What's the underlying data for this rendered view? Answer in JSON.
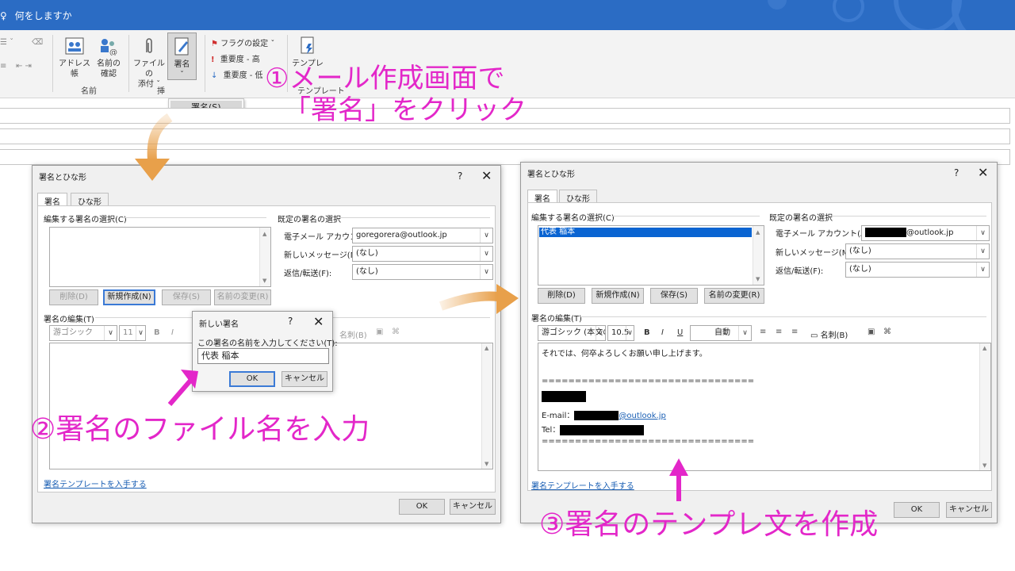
{
  "titlebar": {
    "tell_me": "何をしますか"
  },
  "ribbon": {
    "address_book": "アドレス帳",
    "check_names_line1": "名前の",
    "check_names_line2": "確認",
    "group_names": "名前",
    "attach_line1": "ファイルの",
    "attach_line2": "添付 ˇ",
    "signature": "署名",
    "group_insert_partial": "挿",
    "flag": "フラグの設定 ˇ",
    "high_importance": "重要度 - 高",
    "low_importance": "重要度 - 低",
    "template_line1": "テンプレ",
    "template_group_partial": "テンプレート",
    "dropdown_item": "署名(S)..."
  },
  "dialog_left": {
    "title": "署名とひな形",
    "help": "?",
    "close": "✕",
    "tab_signature": "署名",
    "tab_stationery": "ひな形",
    "select_label": "編集する署名の選択(C)",
    "default_label": "既定の署名の選択",
    "account_label": "電子メール アカウント(A):",
    "account_value": "goregorera@outlook.jp",
    "new_msg_label": "新しいメッセージ(M):",
    "new_msg_value": "(なし)",
    "reply_label": "返信/転送(F):",
    "reply_value": "(なし)",
    "btn_delete": "削除(D)",
    "btn_new": "新規作成(N)",
    "btn_save": "保存(S)",
    "btn_rename": "名前の変更(R)",
    "edit_label": "署名の編集(T)",
    "font_value": "游ゴシック",
    "size_value": "11",
    "bizcard": "名刺(B)",
    "template_link": "署名テンプレートを入手する",
    "ok": "OK",
    "cancel": "キャンセル"
  },
  "new_sig_dialog": {
    "title": "新しい署名",
    "help": "?",
    "close": "✕",
    "prompt": "この署名の名前を入力してください(T):",
    "value": "代表 稲本",
    "ok": "OK",
    "cancel": "キャンセル"
  },
  "dialog_right": {
    "title": "署名とひな形",
    "help": "?",
    "close": "✕",
    "tab_signature": "署名",
    "tab_stationery": "ひな形",
    "select_label": "編集する署名の選択(C)",
    "list_item": "代表 稲本",
    "default_label": "既定の署名の選択",
    "account_label": "電子メール アカウント(A):",
    "account_value": "@outlook.jp",
    "new_msg_label": "新しいメッセージ(M):",
    "new_msg_value": "(なし)",
    "reply_label": "返信/転送(F):",
    "reply_value": "(なし)",
    "btn_delete": "削除(D)",
    "btn_new": "新規作成(N)",
    "btn_save": "保存(S)",
    "btn_rename": "名前の変更(R)",
    "edit_label": "署名の編集(T)",
    "font_value": "游ゴシック (本文の",
    "size_value": "10.5",
    "color_value": "自動",
    "bizcard": "名刺(B)",
    "body_line1": "それでは、何卒よろしくお願い申し上げます。",
    "separator": "================================",
    "email_label": "E-mail：",
    "email_domain": "@outlook.jp",
    "tel_label": "Tel：",
    "template_link": "署名テンプレートを入手する",
    "ok": "OK",
    "cancel": "キャンセル"
  },
  "annotations": {
    "step1_line1": "①メール作成画面で",
    "step1_line2": "「署名」をクリック",
    "step2": "②署名のファイル名を入力",
    "step3": "③署名のテンプレ文を作成"
  },
  "colors": {
    "annotation": "#e327c9",
    "arrow_orange": "#e8a04a",
    "titlebar": "#2b6cc4",
    "selection": "#0a64d2"
  }
}
